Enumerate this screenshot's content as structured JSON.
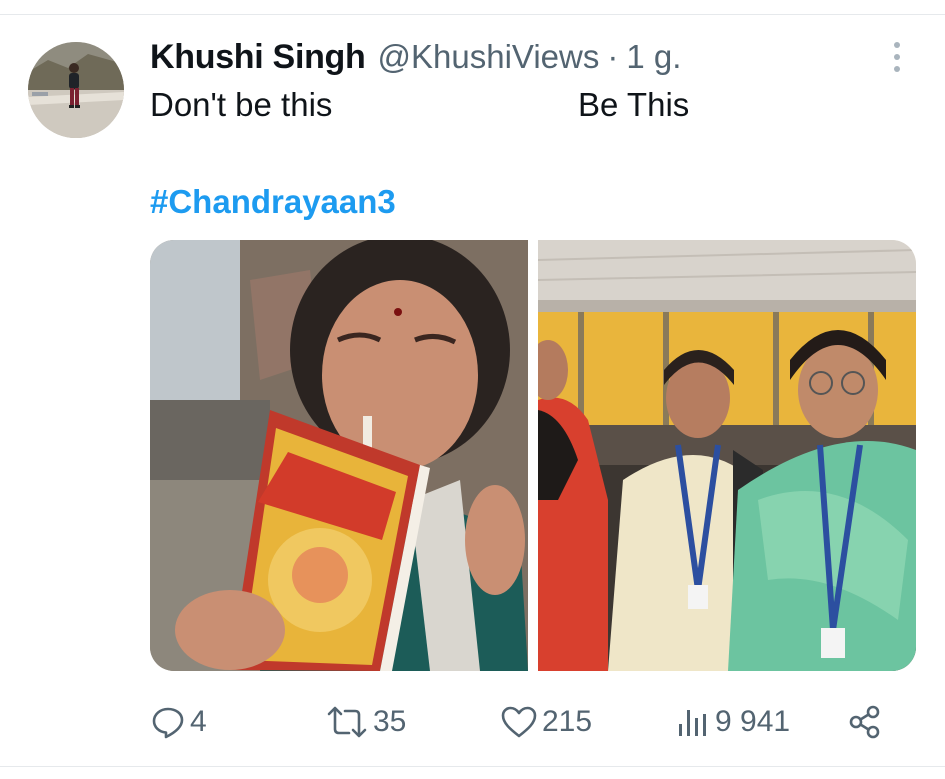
{
  "author": {
    "display_name": "Khushi Singh",
    "handle": "@KhushiViews",
    "separator": "·",
    "time": "1 g."
  },
  "tweet": {
    "line_left": "Don't be this",
    "line_right": "Be This",
    "hashtag": "#Chandrayaan3"
  },
  "media": [
    {
      "name": "photo-left",
      "description_icon": "photo"
    },
    {
      "name": "photo-right",
      "description_icon": "photo"
    }
  ],
  "actions": {
    "reply_count": "4",
    "retweet_count": "35",
    "like_count": "215",
    "view_count": "9 941"
  },
  "colors": {
    "text": "#0f1419",
    "secondary": "#536471",
    "link": "#1d9bf0",
    "divider": "#e6e9ec"
  },
  "icons": [
    "more-icon",
    "reply-icon",
    "retweet-icon",
    "like-icon",
    "views-icon",
    "share-icon"
  ]
}
